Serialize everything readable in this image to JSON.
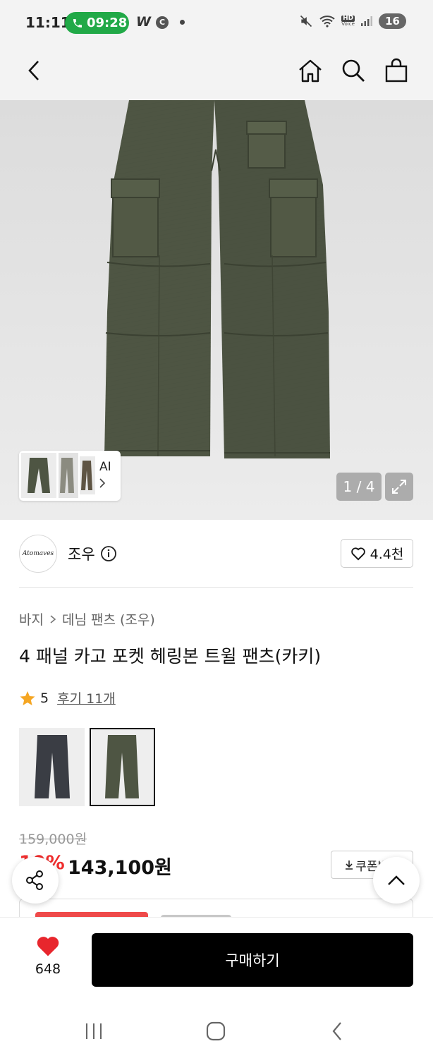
{
  "status_bar": {
    "time": "11:11",
    "call_time": "09:28",
    "app_w": "W",
    "app_c": "C",
    "hd_label": "HD",
    "voice_label": "Voice",
    "battery": "16"
  },
  "header": {
    "back_icon": "chevron-left-icon",
    "home_icon": "home-icon",
    "search_icon": "search-icon",
    "cart_icon": "shopping-bag-icon"
  },
  "gallery": {
    "ai_label": "AI",
    "counter": "1 / 4",
    "background_color": "#e7e7e7",
    "pants_color": "#4e5543"
  },
  "brand": {
    "logo_text": "Atomaves",
    "name": "조우",
    "like_count": "4.4천"
  },
  "breadcrumb": {
    "category": "바지",
    "subcategory": "데님 팬츠 (조우)"
  },
  "product": {
    "title": "4 패널 카고 포켓 헤링본 트윌 팬츠(카키)",
    "rating": "5",
    "reviews": "후기 11개",
    "swatches": [
      {
        "name": "charcoal",
        "color": "#3a3d44"
      },
      {
        "name": "khaki",
        "color": "#4e5543"
      }
    ]
  },
  "pricing": {
    "original_price": "159,000원",
    "discount": "10%",
    "price": "143,100원",
    "coupon_label": "쿠폰받기"
  },
  "buy_bar": {
    "wish_count": "648",
    "buy_label": "구매하기"
  },
  "colors": {
    "discount_red": "#ef2d2d",
    "call_green": "#21a947",
    "heart_red": "#e8262d",
    "star_orange": "#f5a623"
  }
}
